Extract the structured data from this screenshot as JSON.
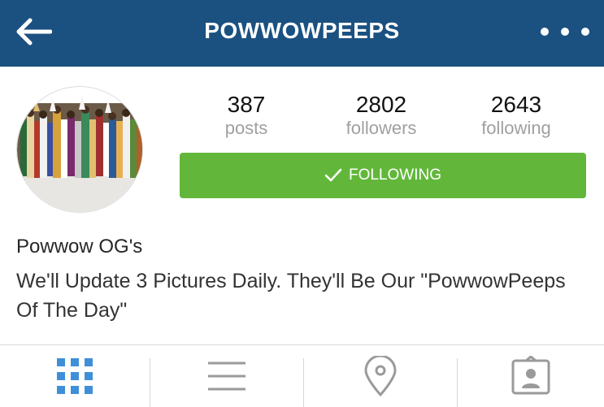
{
  "header": {
    "title": "POWWOWPEEPS",
    "background_color": "#1b5181",
    "back_icon": "arrow-left-icon",
    "more_icon": "more-horizontal-icon"
  },
  "profile": {
    "avatar_description": "group-photo-avatar",
    "stats": [
      {
        "value": "387",
        "label": "posts"
      },
      {
        "value": "2802",
        "label": "followers"
      },
      {
        "value": "2643",
        "label": "following"
      }
    ],
    "follow_button": {
      "label": "FOLLOWING",
      "icon": "check-icon",
      "color": "#62b73a"
    },
    "name": "Powwow OG's",
    "bio": "We'll Update 3 Pictures Daily. They'll Be Our \"PowwowPeeps Of The Day\""
  },
  "tabs": [
    {
      "name": "grid-view",
      "icon": "grid-icon",
      "active": true,
      "active_color": "#3f8fd8"
    },
    {
      "name": "list-view",
      "icon": "list-icon",
      "active": false
    },
    {
      "name": "map-view",
      "icon": "location-pin-icon",
      "active": false
    },
    {
      "name": "tagged-view",
      "icon": "tagged-person-icon",
      "active": false
    }
  ]
}
